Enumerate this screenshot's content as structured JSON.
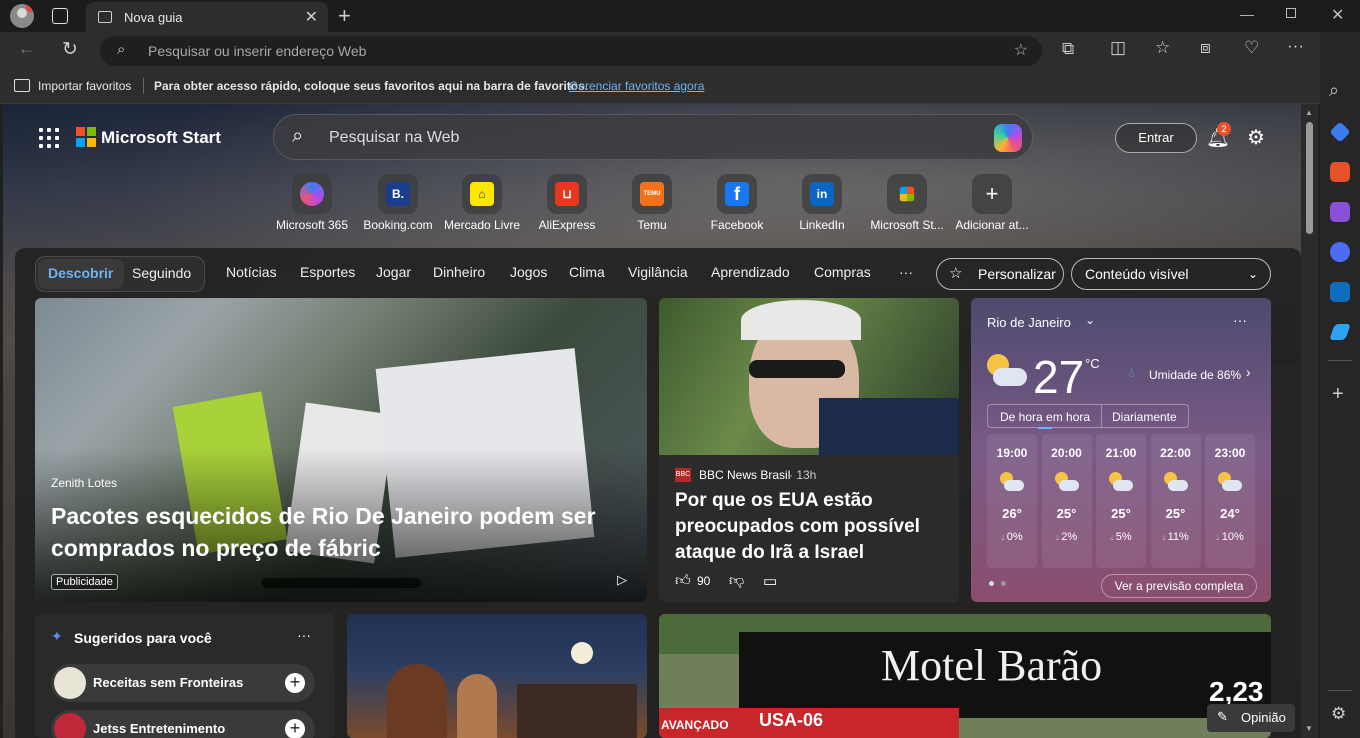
{
  "tab": {
    "title": "Nova guia"
  },
  "omnibox": {
    "placeholder": "Pesquisar ou inserir endereço Web"
  },
  "favorites_bar": {
    "import": "Importar favoritos",
    "hint": "Para obter acesso rápido, coloque seus favoritos aqui na barra de favoritos.",
    "manage_link": "Gerenciar favoritos agora"
  },
  "header": {
    "brand": "Microsoft Start",
    "search_placeholder": "Pesquisar na Web",
    "signin": "Entrar",
    "notifications": "2"
  },
  "quick_links": [
    {
      "label": "Microsoft 365",
      "icon": "m365-icon",
      "color": "#5a6cf0"
    },
    {
      "label": "Booking.com",
      "icon": "booking-icon",
      "color": "#1a3e8c"
    },
    {
      "label": "Mercado Livre",
      "icon": "mercadolivre-icon",
      "color": "#ffe600"
    },
    {
      "label": "AliExpress",
      "icon": "aliexpress-icon",
      "color": "#e8361f"
    },
    {
      "label": "Temu",
      "icon": "temu-icon",
      "color": "#f5701b"
    },
    {
      "label": "Facebook",
      "icon": "facebook-icon",
      "color": "#1877f2"
    },
    {
      "label": "LinkedIn",
      "icon": "linkedin-icon",
      "color": "#0a66c2"
    },
    {
      "label": "Microsoft St...",
      "icon": "store-icon",
      "color": "#333"
    },
    {
      "label": "Adicionar at...",
      "icon": "add-icon",
      "color": "#555"
    }
  ],
  "nav": {
    "discover": "Descobrir",
    "following": "Seguindo",
    "items": [
      "Notícias",
      "Esportes",
      "Jogar",
      "Dinheiro",
      "Jogos",
      "Clima",
      "Vigilância",
      "Aprendizado",
      "Compras"
    ],
    "more": "···",
    "personalize": "Personalizar",
    "visible_content": "Conteúdo visível"
  },
  "hero": {
    "source": "Zenith Lotes",
    "headline": "Pacotes esquecidos de Rio De Janeiro podem ser comprados no preço de fábric",
    "badge": "Publicidade"
  },
  "news": {
    "source": "BBC News Brasil",
    "time": "· 13h",
    "headline": "Por que os EUA estão preocupados com possível ataque do Irã a Israel",
    "likes": "90"
  },
  "weather": {
    "city": "Rio de Janeiro",
    "temp": "27",
    "unit": "°C",
    "humidity": "Umidade de 86%",
    "tab_hourly": "De hora em hora",
    "tab_daily": "Diariamente",
    "hours": [
      {
        "time": "19:00",
        "temp": "26°",
        "rain": "0%"
      },
      {
        "time": "20:00",
        "temp": "25°",
        "rain": "2%"
      },
      {
        "time": "21:00",
        "temp": "25°",
        "rain": "5%"
      },
      {
        "time": "22:00",
        "temp": "25°",
        "rain": "11%"
      },
      {
        "time": "23:00",
        "temp": "24°",
        "rain": "10%"
      }
    ],
    "full_forecast": "Ver a previsão completa"
  },
  "suggested": {
    "title": "Sugeridos para você",
    "items": [
      "Receitas sem Fronteiras",
      "Jetss Entretenimento"
    ]
  },
  "motel": {
    "sign": "Motel Barão",
    "sub": "2,23",
    "bus": "USA-06",
    "side": "AVANÇADO"
  },
  "feedback": {
    "label": "Opinião"
  }
}
